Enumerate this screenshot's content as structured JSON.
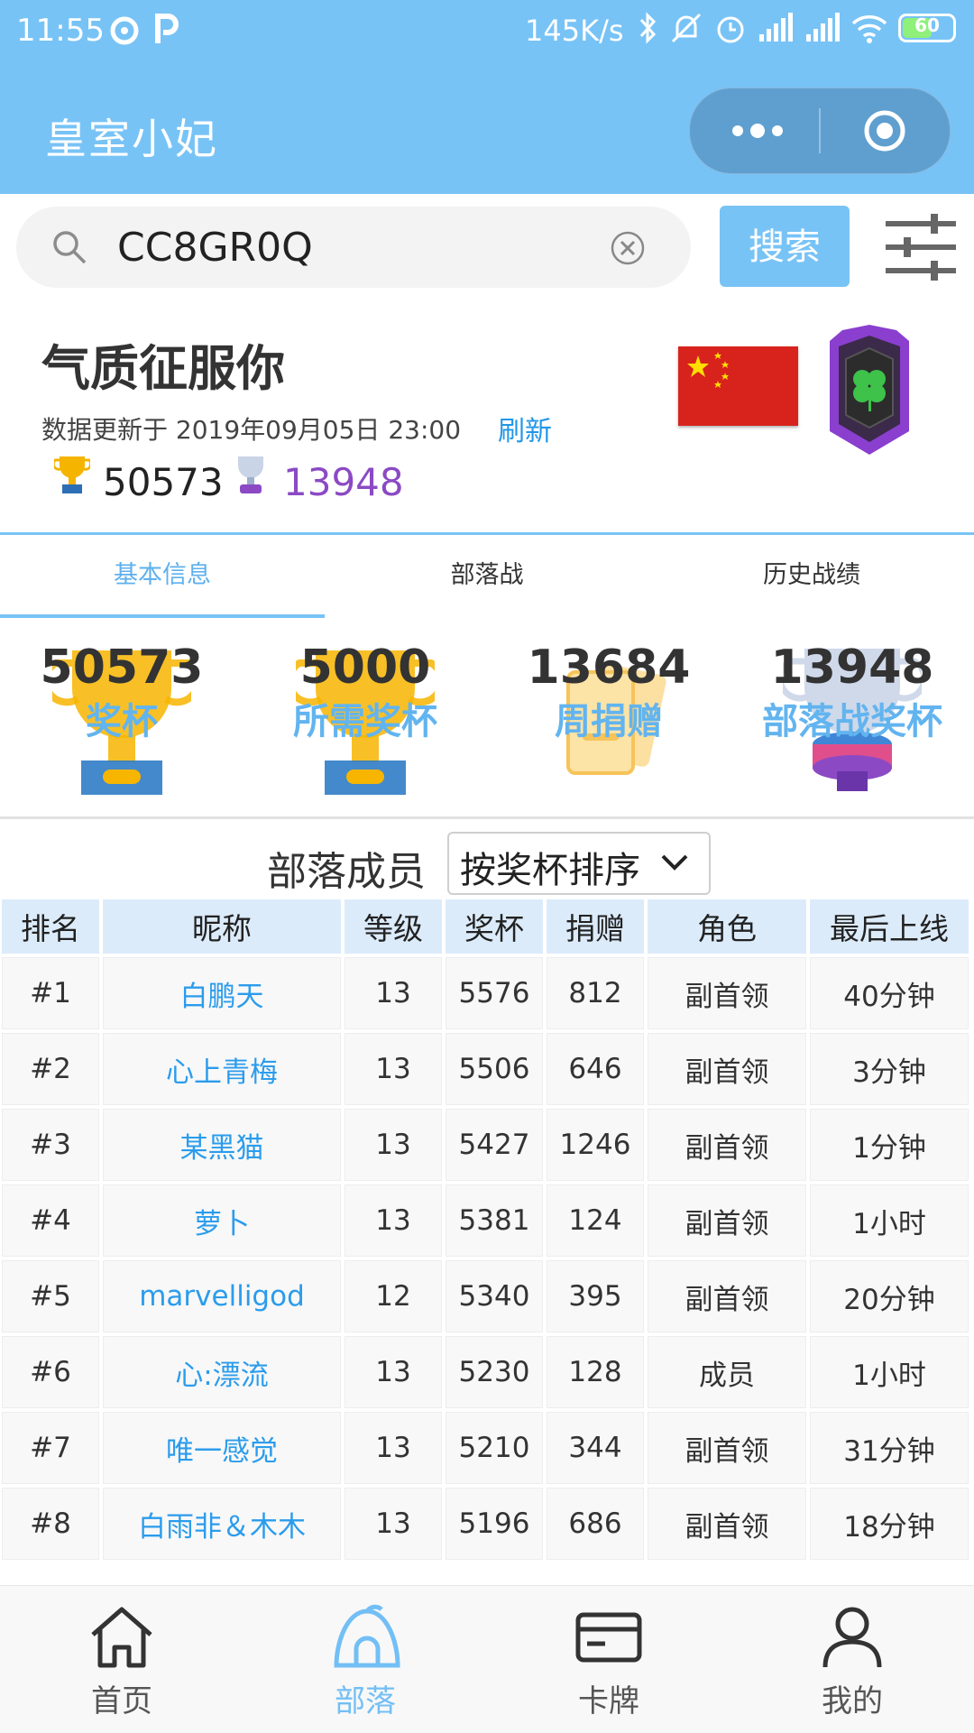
{
  "status_bar": {
    "time": "11:55",
    "speed": "145K/s",
    "battery": "60"
  },
  "app": {
    "title": "皇室小妃"
  },
  "search": {
    "value": "CC8GR0Q",
    "button": "搜索"
  },
  "clan": {
    "name": "气质征服你",
    "updated": "数据更新于 2019年09月05日 23:00",
    "refresh": "刷新",
    "trophies": "50573",
    "war_trophies": "13948"
  },
  "tabs": [
    {
      "label": "基本信息",
      "active": true
    },
    {
      "label": "部落战",
      "active": false
    },
    {
      "label": "历史战绩",
      "active": false
    }
  ],
  "stats": [
    {
      "value": "50573",
      "label": "奖杯",
      "icon": "trophy-icon"
    },
    {
      "value": "5000",
      "label": "所需奖杯",
      "icon": "trophy-icon"
    },
    {
      "value": "13684",
      "label": "周捐赠",
      "icon": "cards-icon"
    },
    {
      "value": "13948",
      "label": "部落战奖杯",
      "icon": "war-trophy-icon"
    }
  ],
  "members": {
    "title": "部落成员",
    "sort": "按奖杯排序",
    "headers": [
      "排名",
      "昵称",
      "等级",
      "奖杯",
      "捐赠",
      "角色",
      "最后上线"
    ],
    "rows": [
      [
        "#1",
        "白鹏天",
        "13",
        "5576",
        "812",
        "副首领",
        "40分钟"
      ],
      [
        "#2",
        "心上青梅",
        "13",
        "5506",
        "646",
        "副首领",
        "3分钟"
      ],
      [
        "#3",
        "某黑猫",
        "13",
        "5427",
        "1246",
        "副首领",
        "1分钟"
      ],
      [
        "#4",
        "萝卜",
        "13",
        "5381",
        "124",
        "副首领",
        "1小时"
      ],
      [
        "#5",
        "marvelligod",
        "12",
        "5340",
        "395",
        "副首领",
        "20分钟"
      ],
      [
        "#6",
        "心:漂流",
        "13",
        "5230",
        "128",
        "成员",
        "1小时"
      ],
      [
        "#7",
        "唯一感觉",
        "13",
        "5210",
        "344",
        "副首领",
        "31分钟"
      ],
      [
        "#8",
        "白雨非＆木木",
        "13",
        "5196",
        "686",
        "副首领",
        "18分钟"
      ]
    ]
  },
  "nav": [
    {
      "label": "首页",
      "icon": "home-icon",
      "active": false
    },
    {
      "label": "部落",
      "icon": "tribe-icon",
      "active": true
    },
    {
      "label": "卡牌",
      "icon": "card-icon",
      "active": false
    },
    {
      "label": "我的",
      "icon": "user-icon",
      "active": false
    }
  ],
  "colors": {
    "primary": "#78c3f6",
    "link": "#2b9cec",
    "purple": "#8b4ac4",
    "gold": "#f5b400"
  }
}
